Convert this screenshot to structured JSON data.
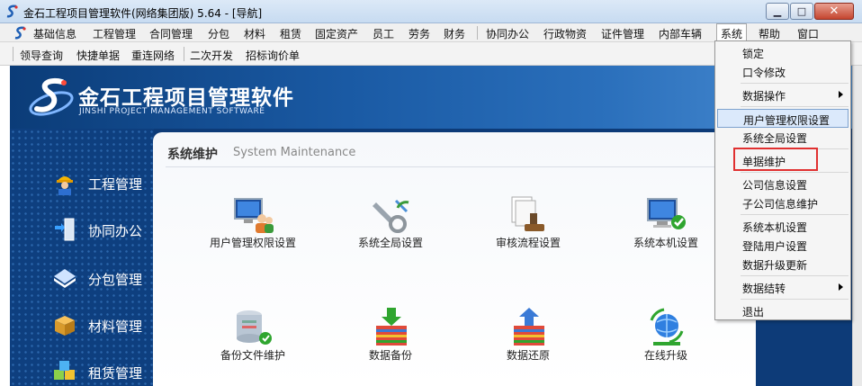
{
  "window": {
    "title": "金石工程项目管理软件(网络集团版) 5.64 - [导航]",
    "min_glyph": "▁",
    "max_glyph": "□",
    "close_glyph": "✕"
  },
  "menubar": {
    "items": [
      "基础信息",
      "工程管理",
      "合同管理",
      "分包",
      "材料",
      "租赁",
      "固定资产",
      "员工",
      "劳务",
      "财务",
      "协同办公",
      "行政物资",
      "证件管理",
      "内部车辆",
      "系统",
      "帮助",
      "窗口"
    ],
    "active": "系统"
  },
  "toolbar": {
    "items": [
      "领导查询",
      "快捷单据",
      "重连网络",
      "二次开发",
      "招标询价单"
    ]
  },
  "banner": {
    "brand_cn": "金石工程项目管理软件",
    "brand_en": "JINSHI PROJECT MANAGEMENT SOFTWARE"
  },
  "nav": {
    "items": [
      {
        "label": "工程管理",
        "icon": "worker-icon"
      },
      {
        "label": "协同办公",
        "icon": "collab-icon"
      },
      {
        "label": "分包管理",
        "icon": "subcontract-icon"
      },
      {
        "label": "材料管理",
        "icon": "box-icon"
      },
      {
        "label": "租赁管理",
        "icon": "cubes-icon"
      }
    ]
  },
  "panel": {
    "title": "系统维护",
    "subtitle": "System Maintenance",
    "tiles": [
      {
        "label": "用户管理权限设置",
        "icon": "users-monitor-icon"
      },
      {
        "label": "系统全局设置",
        "icon": "tools-icon"
      },
      {
        "label": "审核流程设置",
        "icon": "stamp-icon"
      },
      {
        "label": "系统本机设置",
        "icon": "monitor-check-icon"
      },
      {
        "label": "备份文件维护",
        "icon": "database-check-icon"
      },
      {
        "label": "数据备份",
        "icon": "archive-down-icon"
      },
      {
        "label": "数据还原",
        "icon": "archive-up-icon"
      },
      {
        "label": "在线升级",
        "icon": "globe-refresh-icon"
      }
    ]
  },
  "system_menu": {
    "items": [
      "锁定",
      "口令修改",
      "数据操作",
      "用户管理权限设置",
      "系统全局设置",
      "单据维护",
      "公司信息设置",
      "子公司信息维护",
      "系统本机设置",
      "登陆用户设置",
      "数据升级更新",
      "数据结转",
      "退出"
    ],
    "highlighted": "用户管理权限设置",
    "boxed": "单据维护"
  },
  "colors": {
    "banner_dark": "#0b3c78",
    "banner_light": "#4d8fd4",
    "highlight": "#dbe9fb",
    "red_box": "#e03030"
  }
}
